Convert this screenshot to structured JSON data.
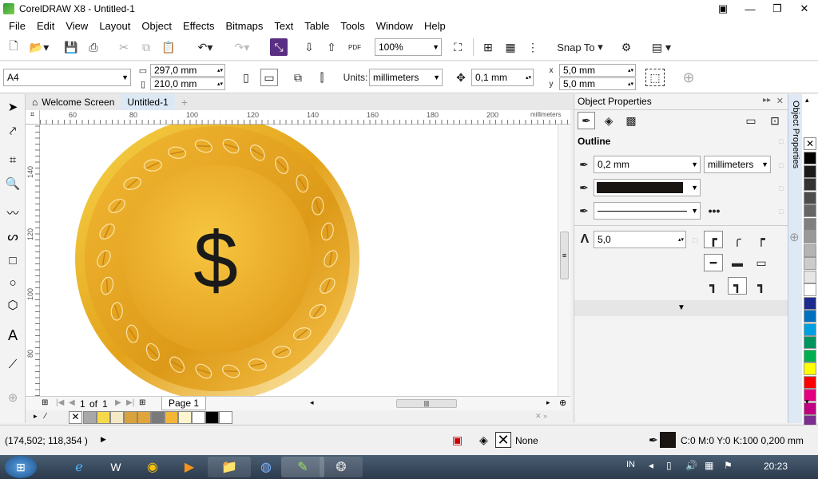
{
  "app": {
    "title": "CorelDRAW X8 - Untitled-1"
  },
  "menu": [
    "File",
    "Edit",
    "View",
    "Layout",
    "Object",
    "Effects",
    "Bitmaps",
    "Text",
    "Table",
    "Tools",
    "Window",
    "Help"
  ],
  "toolbar": {
    "zoom": "100%",
    "snap_to": "Snap To",
    "pdf": "PDF"
  },
  "property_bar": {
    "page_size": "A4",
    "width": "297,0 mm",
    "height": "210,0 mm",
    "units_label": "Units:",
    "units": "millimeters",
    "nudge": "0,1 mm",
    "dup_x": "5,0 mm",
    "dup_y": "5,0 mm"
  },
  "doc_tabs": [
    "Welcome Screen",
    "Untitled-1"
  ],
  "ruler": {
    "top_ticks": [
      "60",
      "80",
      "100",
      "120",
      "140",
      "160",
      "180",
      "200"
    ],
    "unit": "millimeters",
    "left_ticks": [
      "140",
      "120",
      "100",
      "80"
    ]
  },
  "canvas": {
    "symbol": "$"
  },
  "page_nav": {
    "current": "1",
    "of": "of",
    "total": "1",
    "page_tab": "Page 1"
  },
  "object_properties": {
    "title": "Object Properties",
    "section": "Outline",
    "width": "0,2 mm",
    "units": "millimeters",
    "miter": "5,0",
    "docker_tab_label": "Object Properties"
  },
  "status": {
    "coords": "(174,502; 118,354 )",
    "fill": "None",
    "outline": "C:0 M:0 Y:0 K:100  0,200 mm"
  },
  "taskbar": {
    "lang": "IN",
    "time": "20:23"
  },
  "colors": {
    "palette": [
      "#ffffff",
      "#000000",
      "#1a1a1a",
      "#333333",
      "#4d4d4d",
      "#666666",
      "#808080",
      "#999999",
      "#b3b3b3",
      "#cccccc",
      "#e6e6e6",
      "#ffffff",
      "#1d2b8f",
      "#0070c0",
      "#00a0e0",
      "#00945e",
      "#00b050",
      "#ffff00",
      "#ff0000",
      "#e4007f",
      "#c00080",
      "#7b2e8e"
    ],
    "doc_palette": [
      "#a8a8a8",
      "#f5d94a",
      "#f4e9c6",
      "#d9a23a",
      "#e0a53a",
      "#7a7a7a",
      "#f3b637",
      "#fff6d0",
      "#ffffff",
      "#000000",
      "#ffffff"
    ]
  }
}
